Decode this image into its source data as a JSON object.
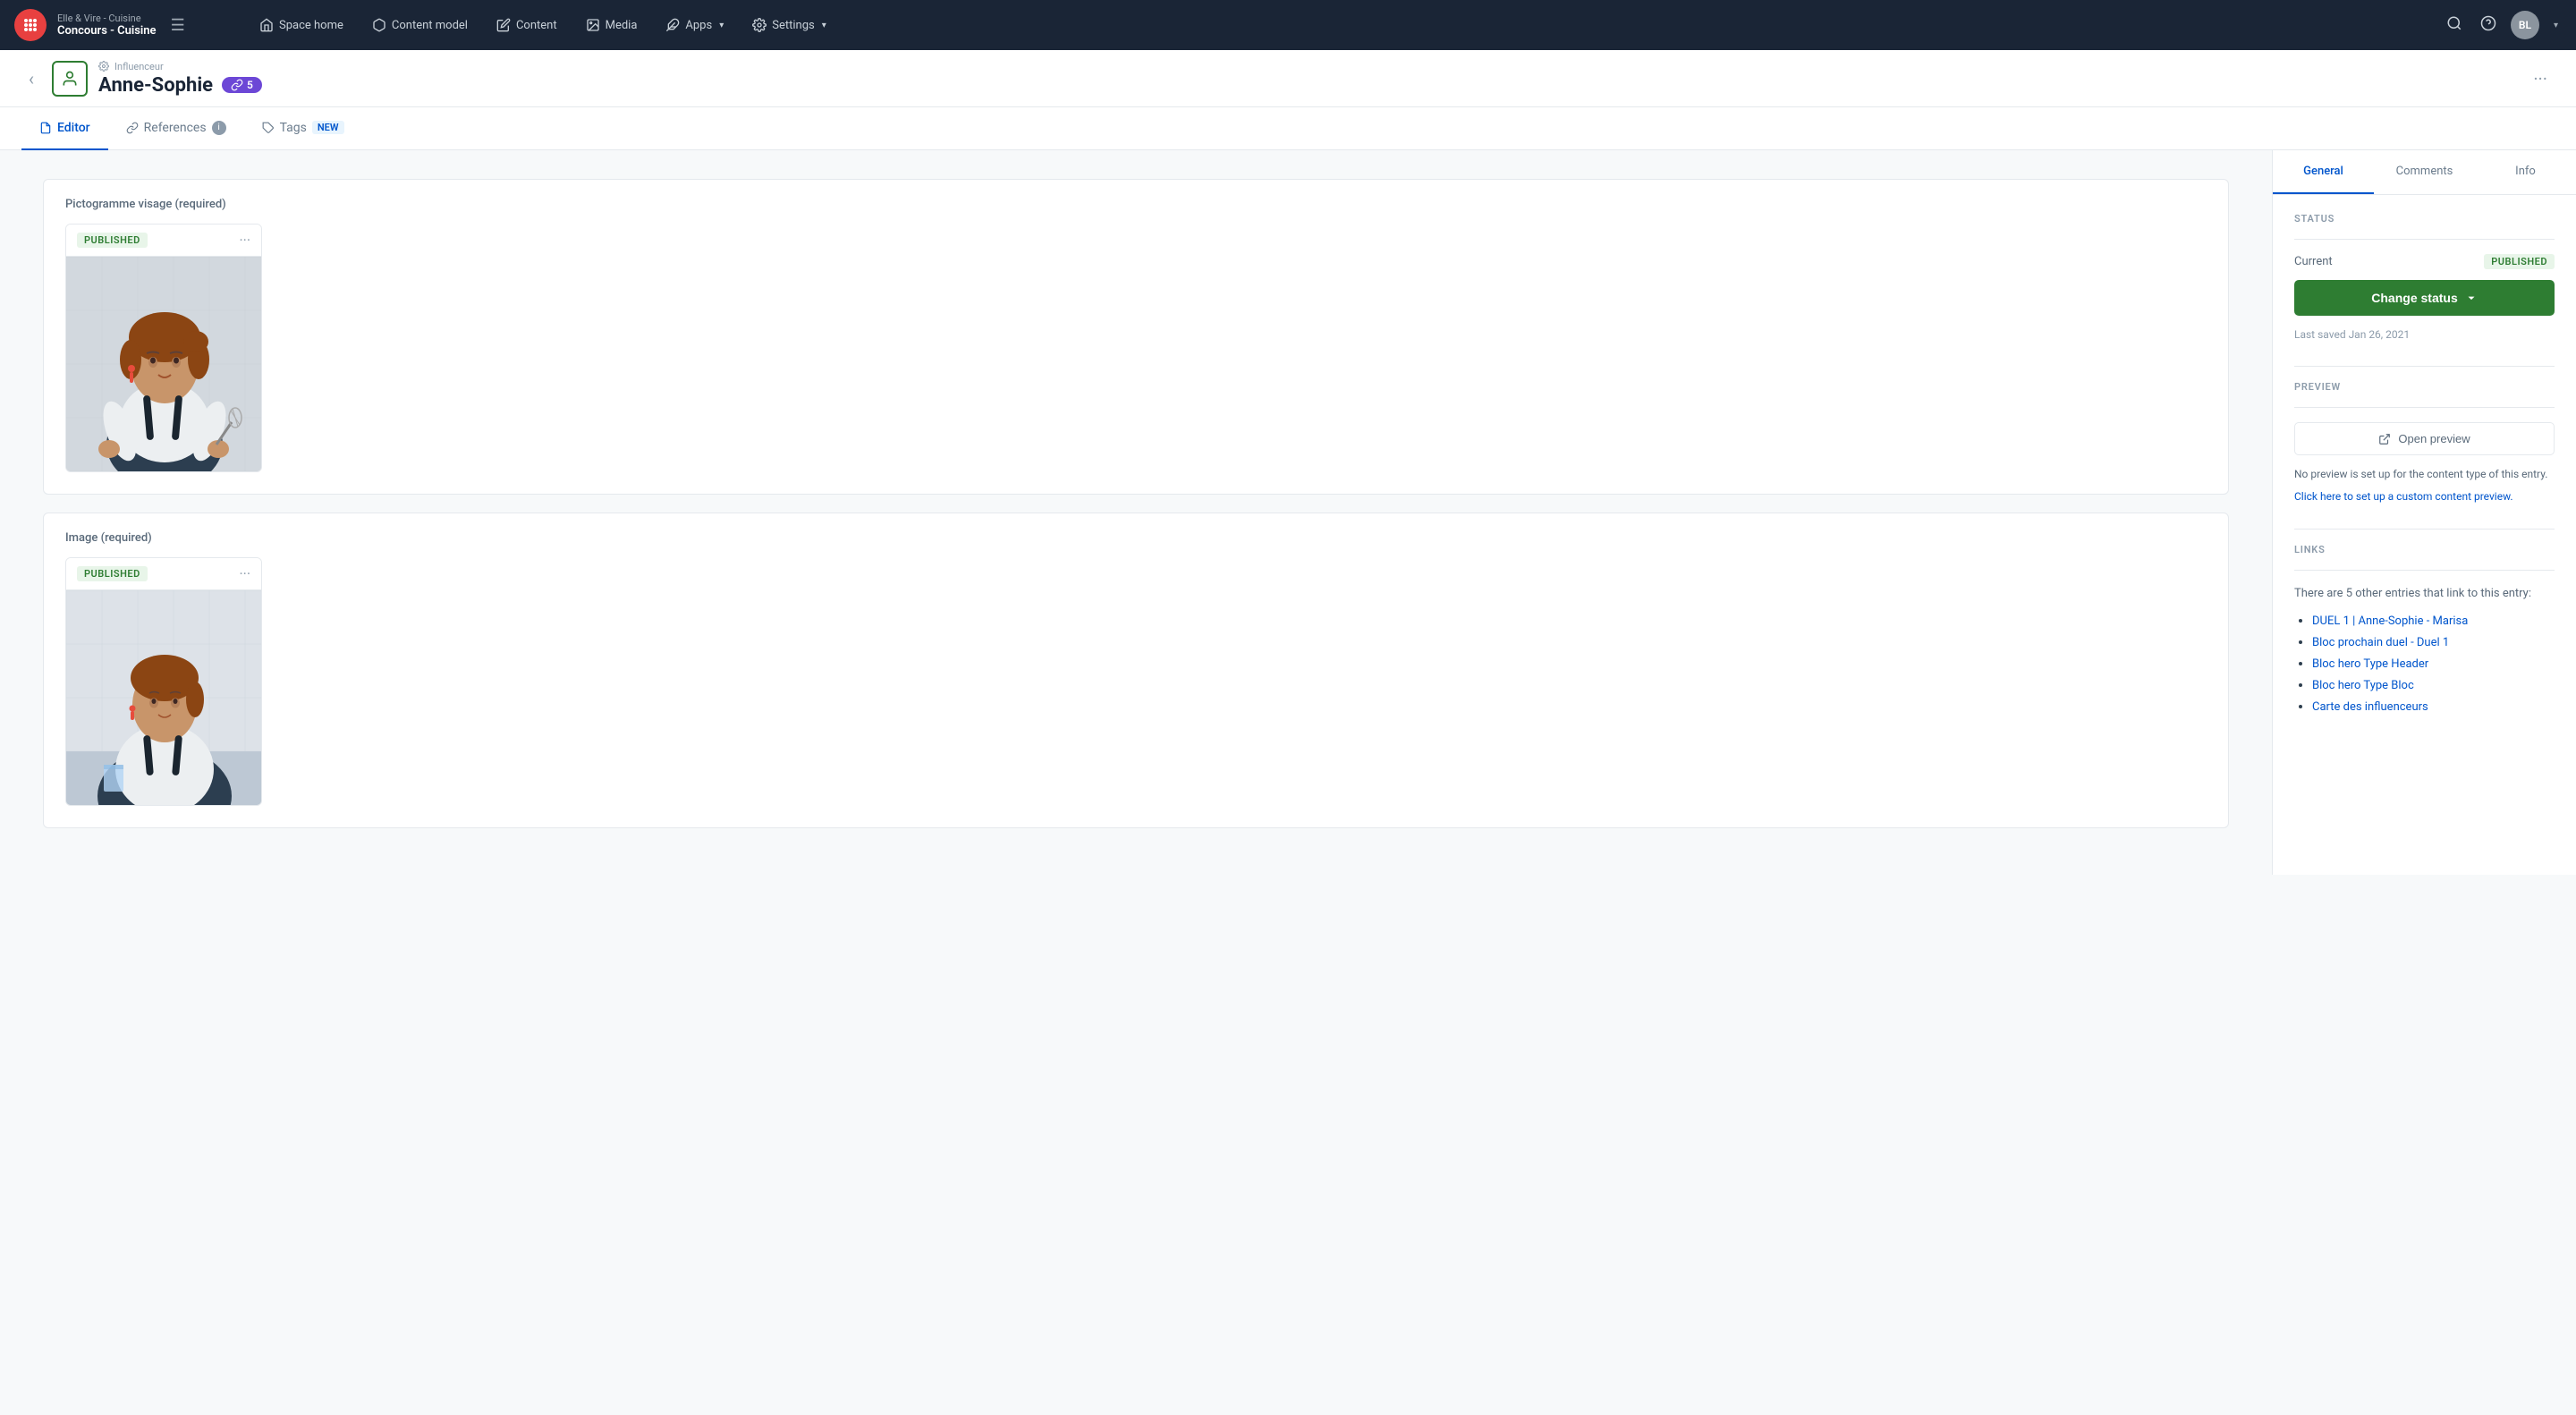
{
  "brand": {
    "subtitle": "Elle & Vire - Cuisine",
    "title": "Concours - Cuisine"
  },
  "nav": {
    "items": [
      {
        "id": "space-home",
        "label": "Space home",
        "icon": "home-icon"
      },
      {
        "id": "content-model",
        "label": "Content model",
        "icon": "cube-icon"
      },
      {
        "id": "content",
        "label": "Content",
        "icon": "edit-icon"
      },
      {
        "id": "media",
        "label": "Media",
        "icon": "image-icon"
      },
      {
        "id": "apps",
        "label": "Apps",
        "icon": "puzzle-icon",
        "hasArrow": true
      },
      {
        "id": "settings",
        "label": "Settings",
        "icon": "gear-icon",
        "hasArrow": true
      }
    ]
  },
  "entry": {
    "content_type": "Influenceur",
    "title": "Anne-Sophie",
    "links_count": 5,
    "back_label": "←",
    "more_label": "···"
  },
  "tabs": [
    {
      "id": "editor",
      "label": "Editor",
      "icon": "file-icon",
      "active": true
    },
    {
      "id": "references",
      "label": "References",
      "icon": "link-icon",
      "has_info": true
    },
    {
      "id": "tags",
      "label": "Tags",
      "icon": "tag-icon",
      "badge": "NEW"
    }
  ],
  "editor": {
    "fields": [
      {
        "id": "pictogramme",
        "label": "Pictogramme visage (required)",
        "asset": {
          "status": "PUBLISHED",
          "alt": "Woman chef with whisk"
        }
      },
      {
        "id": "image",
        "label": "Image (required)",
        "asset": {
          "status": "PUBLISHED",
          "alt": "Woman chef portrait"
        }
      }
    ]
  },
  "sidebar": {
    "tabs": [
      {
        "id": "general",
        "label": "General",
        "active": true
      },
      {
        "id": "comments",
        "label": "Comments"
      },
      {
        "id": "info",
        "label": "Info"
      }
    ],
    "status": {
      "section_label": "STATUS",
      "current_label": "Current",
      "status_value": "PUBLISHED",
      "change_status_label": "Change status",
      "last_saved": "Last saved Jan 26, 2021"
    },
    "preview": {
      "section_label": "PREVIEW",
      "button_label": "Open preview",
      "note": "No preview is set up for the content type of this entry.",
      "link_label": "Click here to set up a custom content preview."
    },
    "links": {
      "section_label": "LINKS",
      "note": "There are 5 other entries that link to this entry:",
      "items": [
        {
          "id": "link1",
          "label": "DUEL 1 | Anne-Sophie - Marisa"
        },
        {
          "id": "link2",
          "label": "Bloc prochain duel - Duel 1"
        },
        {
          "id": "link3",
          "label": "Bloc hero Type Header"
        },
        {
          "id": "link4",
          "label": "Bloc hero Type Bloc"
        },
        {
          "id": "link5",
          "label": "Carte des influenceurs"
        }
      ]
    }
  },
  "avatar": {
    "initials": "BL"
  }
}
